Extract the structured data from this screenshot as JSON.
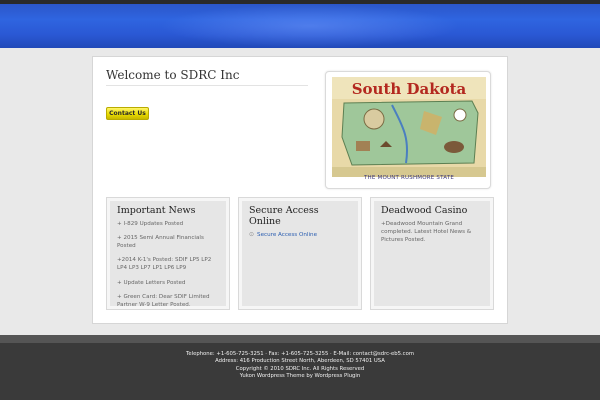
{
  "main": {
    "welcome_title": "Welcome to SDRC Inc",
    "contact_button": "Contact Us",
    "map": {
      "title_text": "South Dakota",
      "caption": "THE MOUNT RUSHMORE STATE"
    }
  },
  "panels": {
    "news": {
      "title": "Important News",
      "items": [
        "+ I-829 Updates Posted",
        "+ 2015 Semi Annual Financials Posted",
        "+2014 K-1's Posted: SDIF LP5 LP2 LP4 LP3 LP7 LP1 LP6 LP9",
        "+ Update Letters Posted",
        "+ Green Card: Dear SDIF Limited Partner W-9 Letter Posted."
      ]
    },
    "secure": {
      "title": "Secure Access Online",
      "link": "Secure Access Online",
      "bullet_icon": "bullet-icon"
    },
    "casino": {
      "title": "Deadwood Casino",
      "text": "+Deadwood Mountain Grand completed. Latest Hotel News & Pictures Posted."
    }
  },
  "footer": {
    "contact_line": "Telephone: +1-605-725-3251 · Fax: +1-605-725-3255 · E-Mail: contact@sdrc-eb5.com",
    "address_line": "Address: 416 Production Street North, Aberdeen, SD 57401 USA",
    "copyright_line": "Copyright © 2010 SDRC Inc. All Rights Reserved",
    "theme_line": "Yukon Wordpress Theme by Wordpress Plugin"
  },
  "colors": {
    "header_blue": "#2f65e0",
    "button_yellow": "#e9dc00",
    "link_blue": "#2a5db0",
    "footer_bg": "#3a3a3a"
  }
}
